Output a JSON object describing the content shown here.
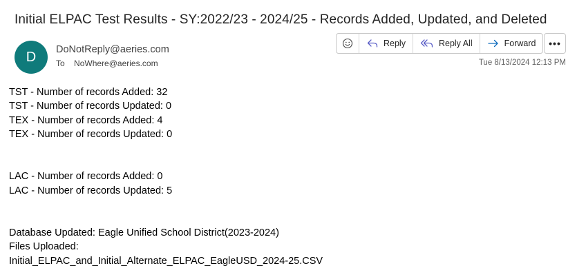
{
  "message": {
    "subject": "Initial ELPAC Test Results - SY:2022/23 - 2024/25 - Records Added, Updated, and Deleted",
    "sender": {
      "initial": "D",
      "email": "DoNotReply@aeries.com",
      "avatar_color": "#0f7b7b"
    },
    "to": {
      "label": "To",
      "address": "NoWhere@aeries.com"
    },
    "date": "Tue 8/13/2024 12:13 PM"
  },
  "toolbar": {
    "emoji_icon": "smiley-icon",
    "reply_label": "Reply",
    "reply_all_label": "Reply All",
    "forward_label": "Forward",
    "more_label": "•••"
  },
  "body": {
    "lines": [
      "TST - Number of records Added: 32",
      "TST - Number of records Updated: 0",
      "TEX - Number of records Added: 4",
      "TEX - Number of records Updated: 0",
      "LAC - Number of records Added: 0",
      "LAC - Number of records Updated: 5",
      "Database Updated: Eagle Unified School District(2023-2024)",
      "Files Uploaded:",
      "Initial_ELPAC_and_Initial_Alternate_ELPAC_EagleUSD_2024-25.CSV"
    ]
  },
  "colors": {
    "accent_blue": "#5b5fc7",
    "forward_blue": "#0f6cbd",
    "avatar_teal": "#0f7b7b"
  }
}
